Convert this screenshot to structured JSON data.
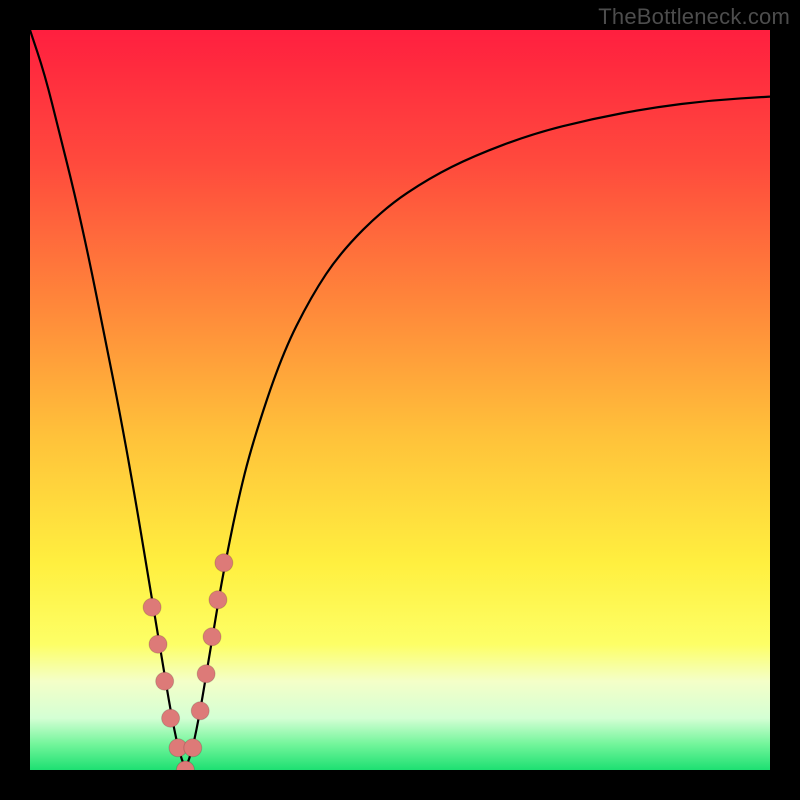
{
  "watermark": "TheBottleneck.com",
  "chart_data": {
    "type": "line",
    "title": "",
    "xlabel": "",
    "ylabel": "",
    "xlim": [
      0,
      100
    ],
    "ylim": [
      0,
      100
    ],
    "grid": false,
    "legend": false,
    "optimal_x": 21,
    "series": [
      {
        "name": "bottleneck-curve",
        "x": [
          0,
          2,
          4,
          6,
          8,
          10,
          12,
          14,
          16,
          17,
          18,
          19,
          20,
          21,
          22,
          23,
          24,
          25,
          26,
          28,
          30,
          34,
          38,
          42,
          48,
          54,
          60,
          68,
          76,
          84,
          92,
          100
        ],
        "y": [
          100,
          94,
          86,
          78,
          69,
          59,
          49,
          38,
          26,
          20,
          14,
          8,
          3,
          0,
          3,
          8,
          14,
          20,
          26,
          36,
          44,
          56,
          64,
          70,
          76,
          80,
          83,
          86,
          88,
          89.5,
          90.5,
          91
        ]
      }
    ],
    "beads": {
      "name": "highlight-beads",
      "x": [
        16.5,
        17.3,
        18.2,
        19.0,
        20.0,
        21.0,
        22.0,
        23.0,
        23.8,
        24.6,
        25.4,
        26.2
      ],
      "y": [
        22,
        17,
        12,
        7,
        3,
        0,
        3,
        8,
        13,
        18,
        23,
        28
      ],
      "radius_px": 9
    },
    "gradient_stops": [
      {
        "offset": 0.0,
        "color": "#ff1f3f"
      },
      {
        "offset": 0.18,
        "color": "#ff4a3d"
      },
      {
        "offset": 0.38,
        "color": "#ff8a3a"
      },
      {
        "offset": 0.55,
        "color": "#ffc23a"
      },
      {
        "offset": 0.72,
        "color": "#ffef3f"
      },
      {
        "offset": 0.83,
        "color": "#fdff66"
      },
      {
        "offset": 0.88,
        "color": "#f4ffc8"
      },
      {
        "offset": 0.93,
        "color": "#d4ffd4"
      },
      {
        "offset": 0.965,
        "color": "#73f59b"
      },
      {
        "offset": 1.0,
        "color": "#1de072"
      }
    ]
  }
}
